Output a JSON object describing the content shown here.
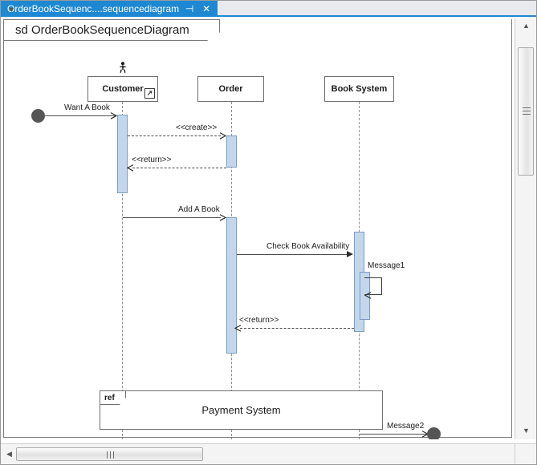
{
  "window": {
    "tab": {
      "title": "OrderBookSequenc....sequencediagram",
      "pin_icon": "pin-icon",
      "pin_glyph": "⊣",
      "close_icon": "close-icon",
      "close_glyph": "✕",
      "active_color": "#1e88d2"
    }
  },
  "diagram": {
    "frame_title": "sd OrderBookSequenceDiagram",
    "kind": "sequence-diagram",
    "colors": {
      "activation_fill": "#c3d7ec",
      "activation_border": "#7e9cc0",
      "line": "#4c4c4c",
      "endpoint": "#555555",
      "frame_border": "#7a7a7a"
    },
    "lifelines": [
      {
        "name": "Customer",
        "has_actor_icon": true,
        "has_badge": true
      },
      {
        "name": "Order",
        "has_actor_icon": false,
        "has_badge": false
      },
      {
        "name": "Book System",
        "has_actor_icon": false,
        "has_badge": false
      }
    ],
    "messages": [
      {
        "label": "Want A Book",
        "style": "solid",
        "direction": "right",
        "arrow": "open"
      },
      {
        "label": "<<create>>",
        "style": "dashed",
        "direction": "right",
        "arrow": "open"
      },
      {
        "label": "<<return>>",
        "style": "dashed",
        "direction": "left",
        "arrow": "open"
      },
      {
        "label": "Add A Book",
        "style": "solid",
        "direction": "right",
        "arrow": "open"
      },
      {
        "label": "Check Book Availability",
        "style": "solid",
        "direction": "right",
        "arrow": "filled"
      },
      {
        "label": "Message1",
        "style": "solid",
        "direction": "self",
        "arrow": "open"
      },
      {
        "label": "<<return>>",
        "style": "dashed",
        "direction": "left",
        "arrow": "open"
      },
      {
        "label": "Message2",
        "style": "solid",
        "direction": "right",
        "arrow": "open"
      }
    ],
    "fragments": [
      {
        "operator": "ref",
        "body": "Payment System"
      }
    ]
  },
  "scrollbars": {
    "vertical": {
      "up_glyph": "▲",
      "down_glyph": "▼"
    },
    "horizontal": {
      "left_glyph": "◀",
      "right_glyph": "▶"
    }
  }
}
